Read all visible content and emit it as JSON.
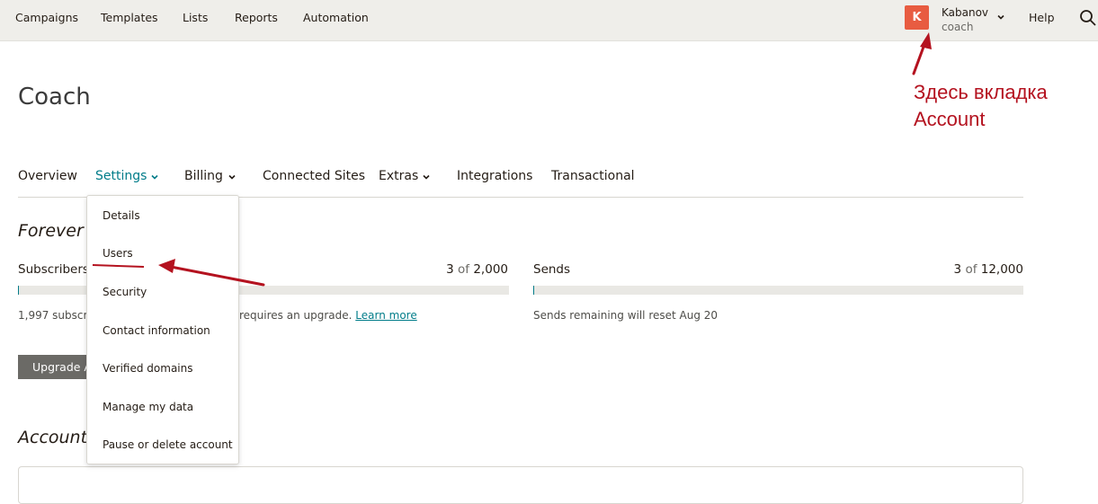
{
  "topnav": {
    "items": [
      "Campaigns",
      "Templates",
      "Lists",
      "Reports",
      "Automation"
    ],
    "avatar_letter": "K",
    "user_name": "Kabanov",
    "user_account": "coach",
    "help_label": "Help"
  },
  "page": {
    "title": "Coach"
  },
  "annotation": {
    "line1": "Здесь вкладка",
    "line2": "Account",
    "color": "#b4121f"
  },
  "subnav": {
    "items": [
      "Overview",
      "Settings",
      "Billing",
      "Connected Sites",
      "Extras",
      "Integrations",
      "Transactional"
    ],
    "active": "Settings"
  },
  "settings_menu": {
    "items": [
      "Details",
      "Users",
      "Security",
      "Contact information",
      "Verified domains",
      "Manage my data",
      "Pause or delete account"
    ]
  },
  "plan": {
    "heading": "Forever F",
    "subscribers": {
      "label": "Subscribers",
      "used": "3",
      "of": "of",
      "limit": "2,000",
      "fill_fraction": 0.0015,
      "note_start": "1,997 subscrib",
      "note_end": "requires an upgrade.",
      "learn_more": "Learn more"
    },
    "sends": {
      "label": "Sends",
      "used": "3",
      "of": "of",
      "limit": "12,000",
      "fill_fraction": 0.00025,
      "note": "Sends remaining will reset Aug 20"
    },
    "upgrade_label": "Upgrade A"
  },
  "account_section": {
    "heading": "Account i"
  },
  "colors": {
    "accent": "#007c89",
    "topbar_bg": "#efeeea",
    "avatar_bg": "#e85c41",
    "button_bg": "#6b6a66"
  }
}
